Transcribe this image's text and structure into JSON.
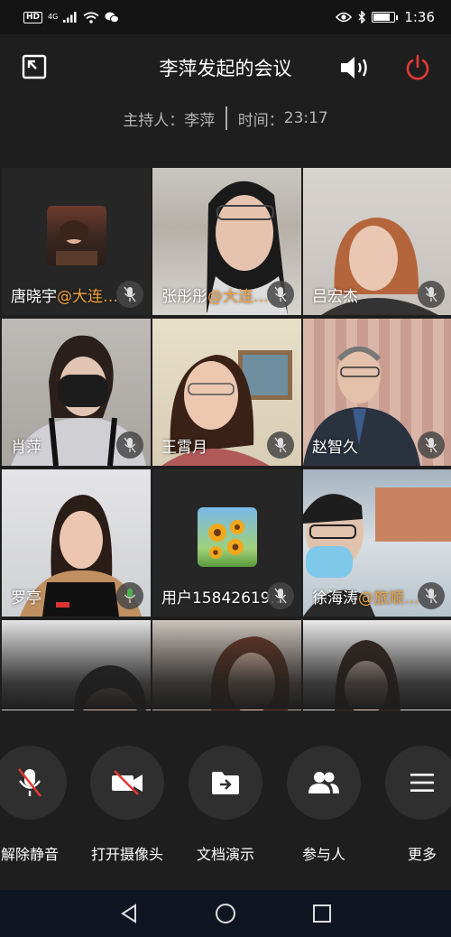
{
  "status_bar": {
    "hd": "HD",
    "network": "4G",
    "time": "1:36",
    "battery_level": 0.82
  },
  "header": {
    "title": "李萍发起的会议",
    "host_label": "主持人：",
    "host_name": "李萍",
    "time_label": "时间：",
    "time_value": "23:17"
  },
  "participants": [
    {
      "name": "唐晓宇",
      "org": "@大连…",
      "muted": true
    },
    {
      "name": "张彤彤",
      "org": "@大连…",
      "muted": true
    },
    {
      "name": "吕宏杰",
      "org": "",
      "muted": true
    },
    {
      "name": "肖萍",
      "org": "",
      "muted": true
    },
    {
      "name": "王霄月",
      "org": "",
      "muted": true
    },
    {
      "name": "赵智久",
      "org": "",
      "muted": true
    },
    {
      "name": "罗亭",
      "org": "",
      "muted": false
    },
    {
      "name": "用户15842619…",
      "org": "",
      "muted": true
    },
    {
      "name": "徐海涛",
      "org": "@旅顺…",
      "muted": true
    }
  ],
  "toolbar": {
    "unmute": "解除静音",
    "camera": "打开摄像头",
    "share_doc": "文档演示",
    "participants": "参与人",
    "more": "更多"
  },
  "colors": {
    "accent_org": "#f0a03c",
    "power_red": "#e53935",
    "background": "#1e1e1e"
  },
  "icons": [
    "exit-fullscreen-icon",
    "speaker-icon",
    "power-icon",
    "mic-off-icon",
    "camera-off-icon",
    "folder-share-icon",
    "people-icon",
    "menu-icon",
    "back-icon",
    "home-icon",
    "recents-icon"
  ]
}
